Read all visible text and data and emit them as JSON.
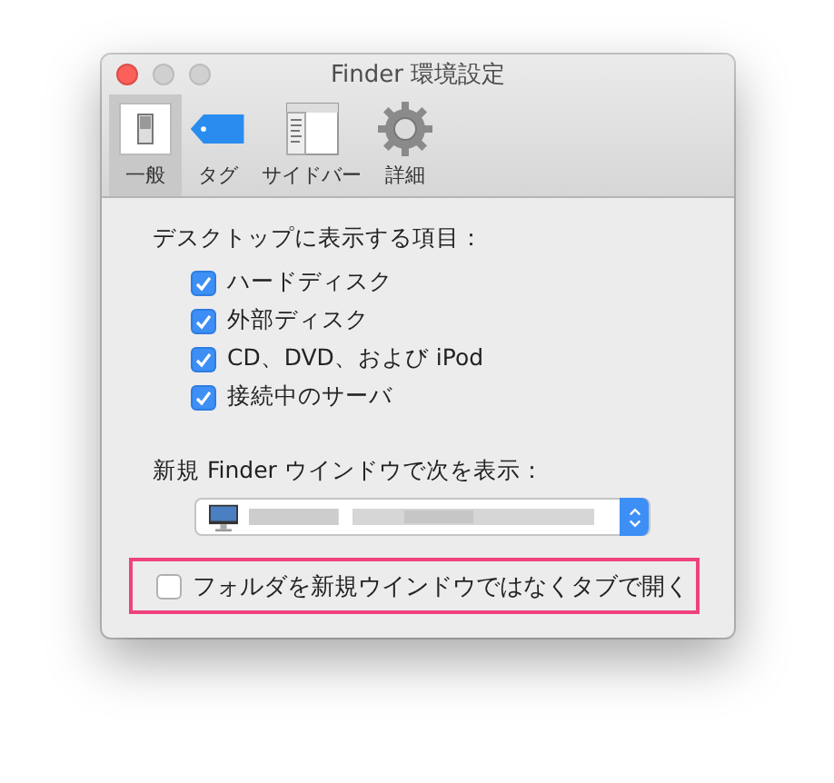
{
  "window": {
    "title": "Finder 環境設定"
  },
  "tabs": [
    {
      "label": "一般",
      "kind": "general",
      "selected": true
    },
    {
      "label": "タグ",
      "kind": "tags",
      "selected": false
    },
    {
      "label": "サイドバー",
      "kind": "sidebar",
      "selected": false
    },
    {
      "label": "詳細",
      "kind": "advanced",
      "selected": false
    }
  ],
  "desktop_items": {
    "heading": "デスクトップに表示する項目：",
    "items": [
      {
        "label": "ハードディスク",
        "checked": true
      },
      {
        "label": "外部ディスク",
        "checked": true
      },
      {
        "label": "CD、DVD、および iPod",
        "checked": true
      },
      {
        "label": "接続中のサーバ",
        "checked": true
      }
    ]
  },
  "new_window": {
    "label": "新規 Finder ウインドウで次を表示："
  },
  "open_in_tabs": {
    "label": "フォルダを新規ウインドウではなくタブで開く",
    "checked": false,
    "highlighted": true
  }
}
